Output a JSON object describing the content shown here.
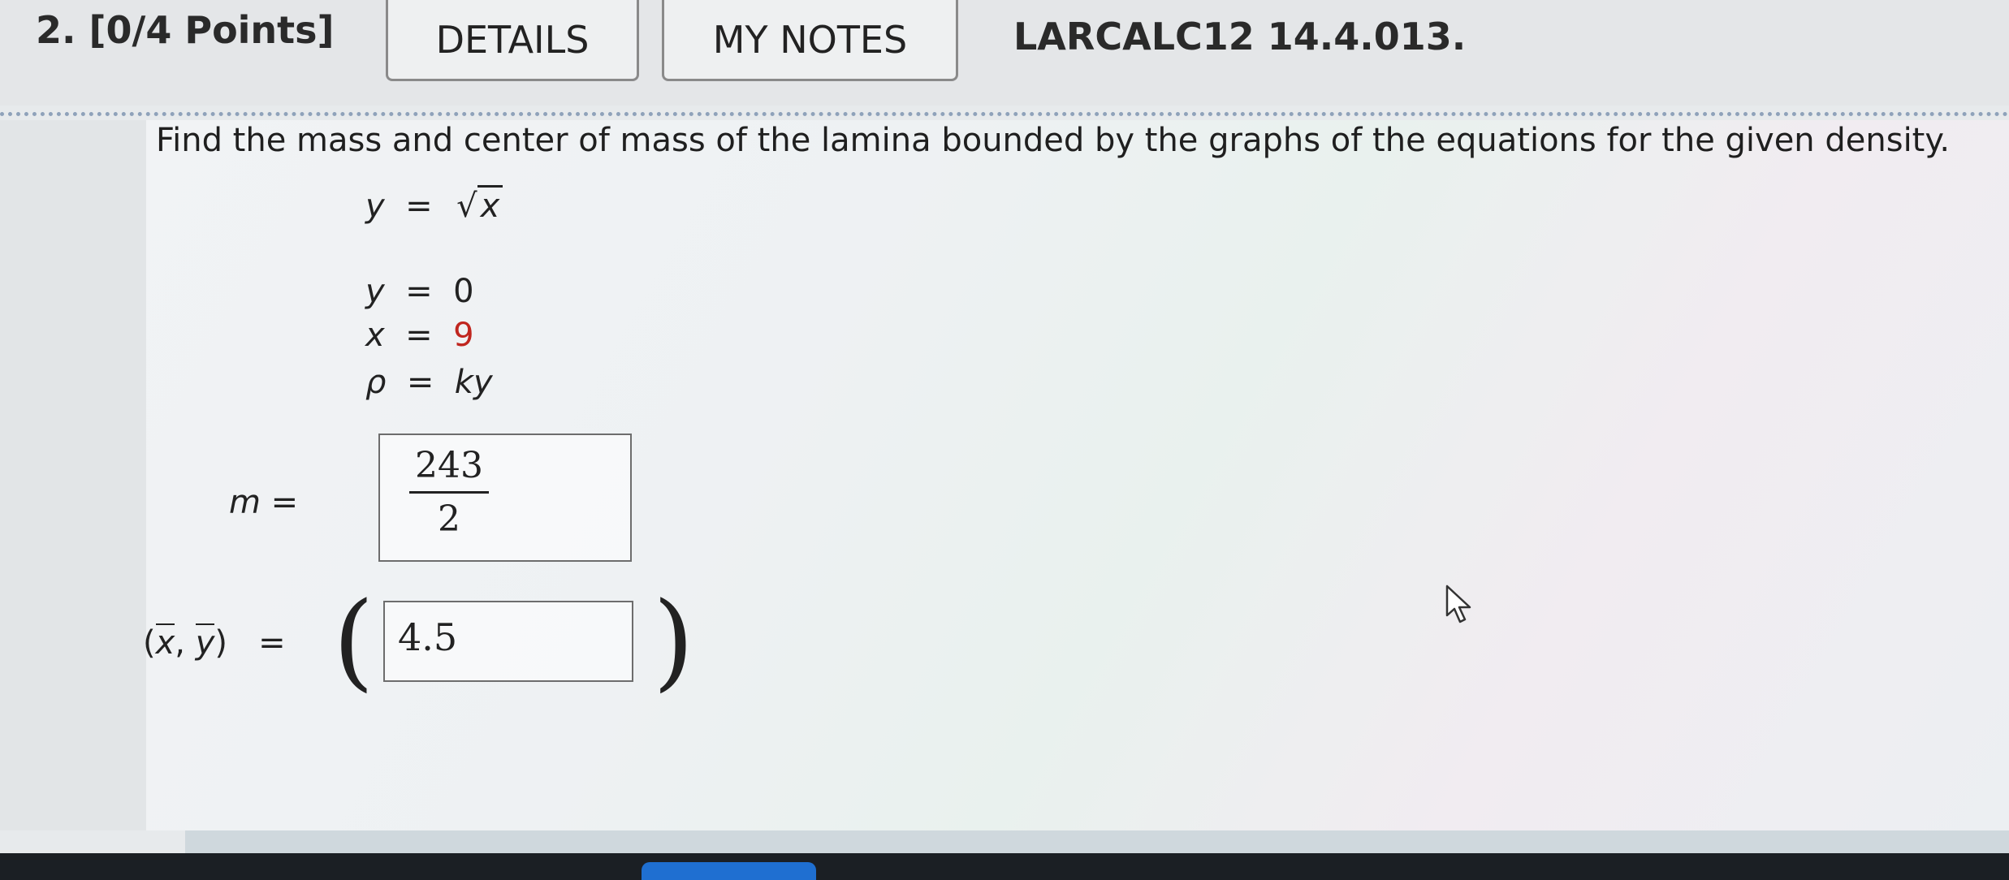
{
  "header": {
    "question_number": "2.  [0/4 Points]",
    "details_label": "DETAILS",
    "my_notes_label": "MY NOTES",
    "question_code": "LARCALC12 14.4.013."
  },
  "question": {
    "prompt": "Find the mass and center of mass of the lamina bounded by the graphs of the equations for the given density.",
    "equations": [
      {
        "lhs": "y",
        "op": "=",
        "rhs": "x",
        "form": "sqrt"
      },
      {
        "lhs": "y",
        "op": "=",
        "rhs": "0"
      },
      {
        "lhs": "x",
        "op": "=",
        "rhs": "9",
        "rhs_color": "#c0261f"
      },
      {
        "lhs": "ρ",
        "op": "=",
        "rhs": "ky"
      }
    ]
  },
  "answers": {
    "mass_label": "m  =",
    "mass_numerator": "243",
    "mass_denominator": "2",
    "center_label_x": "x",
    "center_label_y": "y",
    "center_open": "(",
    "center_sep": ", ",
    "center_close": ")",
    "center_eq": "=",
    "center_x_value": "4.5"
  },
  "icons": {
    "pointer": "mouse-pointer-icon"
  }
}
